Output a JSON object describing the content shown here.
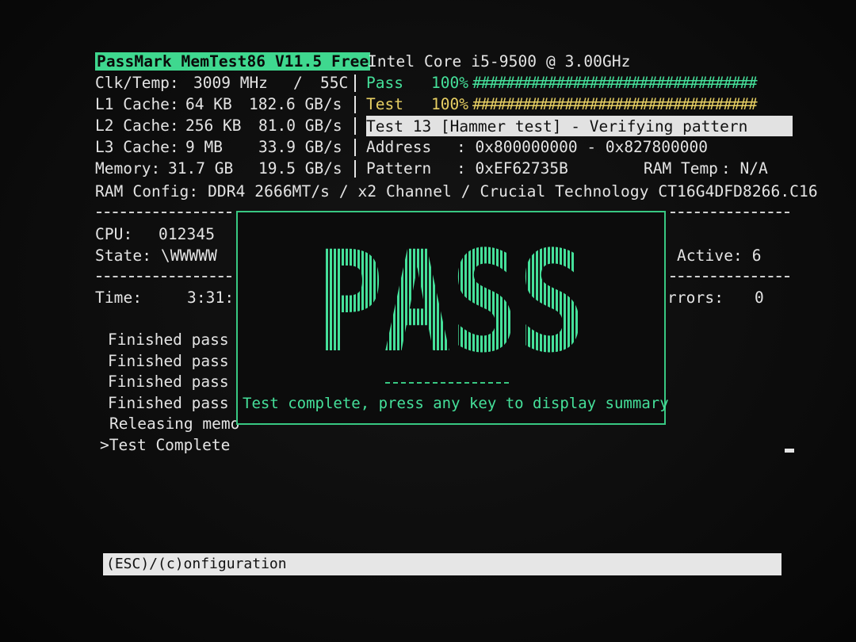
{
  "header": {
    "app_title": "PassMark MemTest86 V11.5 Free",
    "cpu_model": "Intel Core i5-9500 @ 3.00GHz"
  },
  "system": {
    "clk_temp_label": "Clk/Temp:",
    "clk_value": "3009 MHz",
    "clk_sep": "/",
    "temp_value": "55C",
    "l1": {
      "label": "L1 Cache:",
      "size": "64 KB",
      "speed": "182.6 GB/s"
    },
    "l2": {
      "label": "L2 Cache:",
      "size": "256 KB",
      "speed": "81.0 GB/s"
    },
    "l3": {
      "label": "L3 Cache:",
      "size": "9 MB",
      "speed": "33.9 GB/s"
    },
    "memory": {
      "label": "Memory:",
      "size": "31.7 GB",
      "speed": "19.5 GB/s"
    },
    "ram_config_label": "RAM Config:",
    "ram_config_value": "DDR4 2666MT/s / x2 Channel / Crucial Technology CT16G4DFD8266.C16"
  },
  "progress": {
    "pass_label": "Pass",
    "pass_percent": "100%",
    "pass_bar": "##################################",
    "test_label": "Test",
    "test_percent": "100%",
    "test_bar": "##################################",
    "current_test": "Test 13 [Hammer test] - Verifying pattern",
    "address_label": "Address",
    "address_value": ": 0x800000000 - 0x827800000",
    "pattern_label": "Pattern",
    "pattern_value": ": 0xEF62735B",
    "ram_temp_label": "RAM Temp",
    "ram_temp_value": ": N/A"
  },
  "cpu_panel": {
    "cpu_label": "CPU:",
    "cpu_value": "012345",
    "state_label": "State:",
    "state_value": "\\WWWWW",
    "active_label": "Active:",
    "active_value": "6"
  },
  "status": {
    "time_label": "Time:",
    "time_value": "3:31:",
    "errors_label": "rrors:",
    "errors_value": "0"
  },
  "log": [
    "Finished pass",
    "Finished pass",
    "Finished pass",
    "Finished pass",
    "Releasing memo",
    ">Test Complete"
  ],
  "result_box": {
    "result": "PASS",
    "message": "Test complete, press any key to display summary",
    "accent_color": "#45e09a"
  },
  "footer": {
    "hint": "(ESC)/(c)onfiguration"
  }
}
